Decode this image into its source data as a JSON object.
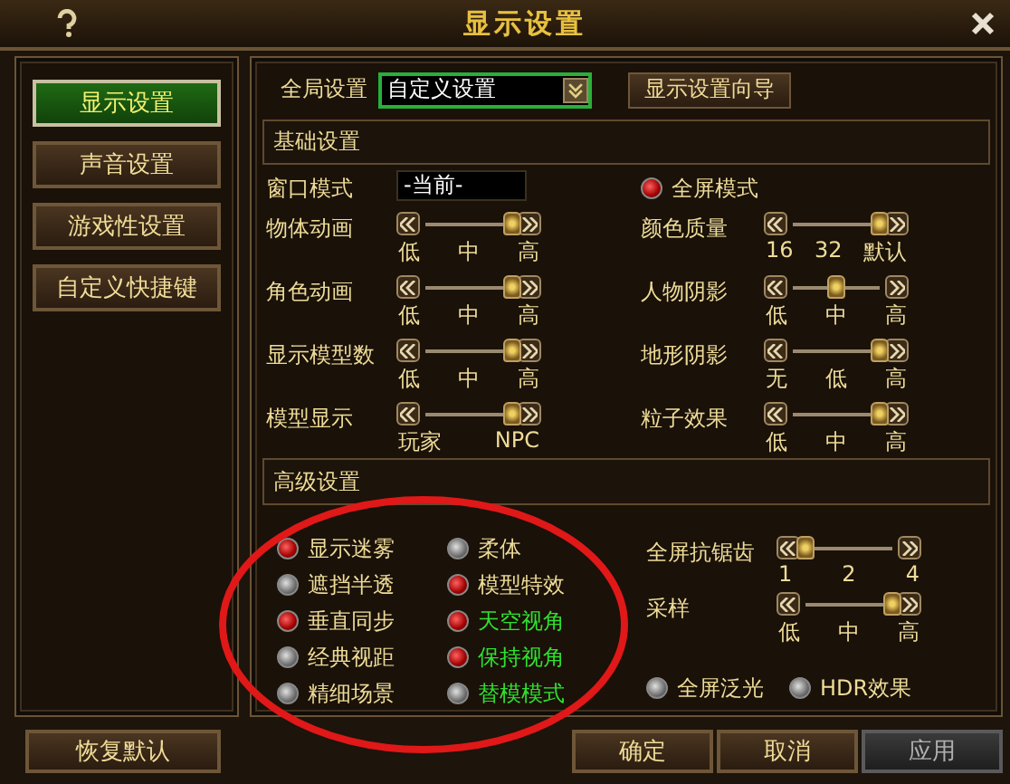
{
  "window": {
    "title": "显示设置"
  },
  "sidebar": {
    "items": [
      {
        "label": "显示设置",
        "selected": true
      },
      {
        "label": "声音设置",
        "selected": false
      },
      {
        "label": "游戏性设置",
        "selected": false
      },
      {
        "label": "自定义快捷键",
        "selected": false
      }
    ]
  },
  "global": {
    "label": "全局设置",
    "value": "自定义设置",
    "wizard_button": "显示设置向导"
  },
  "basic": {
    "title": "基础设置",
    "window_mode": {
      "label": "窗口模式",
      "value": "-当前-"
    },
    "fullscreen": {
      "label": "全屏模式",
      "checked": true
    },
    "sliders": [
      {
        "label": "物体动画",
        "level": 1,
        "ticks": [
          "低",
          "中",
          "高"
        ]
      },
      {
        "label": "颜色质量",
        "level": 1,
        "ticks": [
          "16",
          "32",
          "默认"
        ]
      },
      {
        "label": "角色动画",
        "level": 1,
        "ticks": [
          "低",
          "中",
          "高"
        ]
      },
      {
        "label": "人物阴影",
        "level": 0.5,
        "ticks": [
          "低",
          "中",
          "高"
        ]
      },
      {
        "label": "显示模型数",
        "level": 1,
        "ticks": [
          "低",
          "中",
          "高"
        ]
      },
      {
        "label": "地形阴影",
        "level": 1,
        "ticks": [
          "无",
          "低",
          "高"
        ]
      },
      {
        "label": "模型显示",
        "level": 1,
        "ticks": [
          "玩家",
          "NPC"
        ]
      },
      {
        "label": "粒子效果",
        "level": 1,
        "ticks": [
          "低",
          "中",
          "高"
        ]
      }
    ]
  },
  "advanced": {
    "title": "高级设置",
    "options": [
      {
        "label": "显示迷雾",
        "checked": true,
        "highlighted": false
      },
      {
        "label": "柔体",
        "checked": false,
        "highlighted": false
      },
      {
        "label": "遮挡半透",
        "checked": false,
        "highlighted": false
      },
      {
        "label": "模型特效",
        "checked": true,
        "highlighted": false
      },
      {
        "label": "垂直同步",
        "checked": true,
        "highlighted": false
      },
      {
        "label": "天空视角",
        "checked": true,
        "highlighted": true
      },
      {
        "label": "经典视距",
        "checked": false,
        "highlighted": false
      },
      {
        "label": "保持视角",
        "checked": true,
        "highlighted": true
      },
      {
        "label": "精细场景",
        "checked": false,
        "highlighted": false
      },
      {
        "label": "替模模式",
        "checked": false,
        "highlighted": true
      }
    ],
    "sliders": [
      {
        "label": "全屏抗锯齿",
        "level": 0,
        "ticks": [
          "1",
          "2",
          "4"
        ]
      },
      {
        "label": "采样",
        "level": 1,
        "ticks": [
          "低",
          "中",
          "高"
        ]
      }
    ],
    "effects": [
      {
        "label": "全屏泛光",
        "checked": false
      },
      {
        "label": "HDR效果",
        "checked": false
      }
    ]
  },
  "footer": {
    "restore": "恢复默认",
    "buttons": [
      {
        "label": "确定",
        "disabled": false
      },
      {
        "label": "取消",
        "disabled": false
      },
      {
        "label": "应用",
        "disabled": true
      }
    ]
  },
  "annotations": [
    {
      "kind": "ellipse",
      "color": "#e01818"
    }
  ]
}
